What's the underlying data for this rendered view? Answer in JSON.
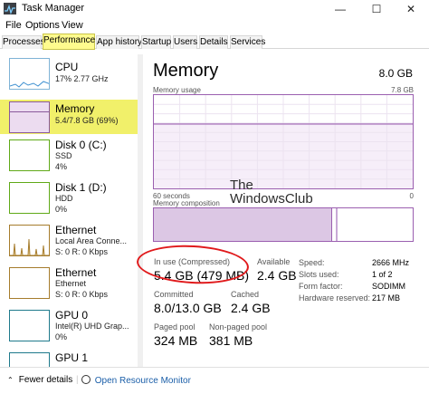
{
  "window": {
    "title": "Task Manager",
    "minimize": "—",
    "maximize": "☐",
    "close": "✕"
  },
  "menu": {
    "items": [
      "File",
      "Options",
      "View"
    ]
  },
  "tabs": [
    "Processes",
    "Performance",
    "App history",
    "Startup",
    "Users",
    "Details",
    "Services"
  ],
  "active_tab": "Performance",
  "sidebar": {
    "items": [
      {
        "title": "CPU",
        "sub1": "17% 2.77 GHz",
        "sub2": ""
      },
      {
        "title": "Memory",
        "sub1": "5.4/7.8 GB (69%)",
        "sub2": ""
      },
      {
        "title": "Disk 0 (C:)",
        "sub1": "SSD",
        "sub2": "4%"
      },
      {
        "title": "Disk 1 (D:)",
        "sub1": "HDD",
        "sub2": "0%"
      },
      {
        "title": "Ethernet",
        "sub1": "Local Area Conne...",
        "sub2": "S: 0 R: 0 Kbps"
      },
      {
        "title": "Ethernet",
        "sub1": "Ethernet",
        "sub2": "S: 0 R: 0 Kbps"
      },
      {
        "title": "GPU 0",
        "sub1": "Intel(R) UHD Grap...",
        "sub2": "0%"
      },
      {
        "title": "GPU 1",
        "sub1": "",
        "sub2": ""
      }
    ]
  },
  "memory": {
    "title": "Memory",
    "total": "8.0 GB",
    "usage_label": "Memory usage",
    "usage_max": "7.8 GB",
    "usage_fraction": 0.69,
    "time_label": "60 seconds",
    "time_end": "0",
    "composition_label": "Memory composition",
    "in_use_label": "In use (Compressed)",
    "in_use_value": "5.4 GB (479 MB)",
    "available_label": "Available",
    "available_value": "2.4 GB",
    "committed_label": "Committed",
    "committed_value": "8.0/13.0 GB",
    "cached_label": "Cached",
    "cached_value": "2.4 GB",
    "paged_label": "Paged pool",
    "paged_value": "324 MB",
    "nonpaged_label": "Non-paged pool",
    "nonpaged_value": "381 MB",
    "speed_label": "Speed:",
    "speed_value": "2666 MHz",
    "slots_label": "Slots used:",
    "slots_value": "1 of 2",
    "form_label": "Form factor:",
    "form_value": "SODIMM",
    "hwres_label": "Hardware reserved:",
    "hwres_value": "217 MB"
  },
  "watermark": {
    "line1": "The",
    "line2": "WindowsClub"
  },
  "footer": {
    "fewer_details": "Fewer details",
    "open_monitor": "Open Resource Monitor"
  },
  "colors": {
    "memory_accent": "#9b5fb0",
    "highlight": "#fffb8e",
    "annotation": "#e0191b"
  }
}
